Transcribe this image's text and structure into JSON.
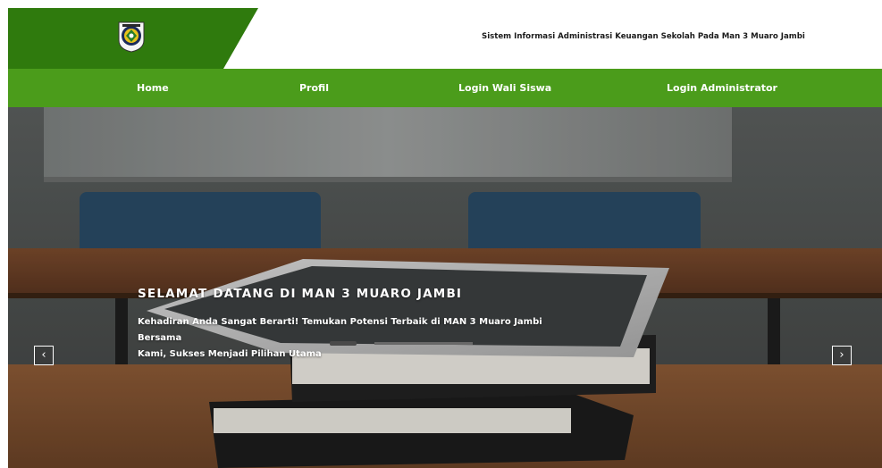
{
  "header": {
    "site_title": "Sistem Informasi Administrasi Keuangan Sekolah Pada Man 3 Muaro Jambi",
    "logo_icon": "school-emblem-icon"
  },
  "nav": {
    "items": [
      {
        "label": "Home"
      },
      {
        "label": "Profil"
      },
      {
        "label": "Login Wali Siswa"
      },
      {
        "label": "Login Administrator"
      }
    ]
  },
  "hero": {
    "title": "SELAMAT DATANG DI MAN 3 MUARO JAMBI",
    "line1": "Kehadiran Anda Sangat Berarti! Temukan Potensi Terbaik di MAN 3 Muaro Jambi Bersama",
    "line2": "Kami, Sukses Menjadi Pilihan Utama",
    "prev_glyph": "‹",
    "next_glyph": "›"
  },
  "colors": {
    "dark_green": "#2f7a0d",
    "nav_green": "#4b9c1b",
    "text_dark": "#1b1b1b"
  }
}
